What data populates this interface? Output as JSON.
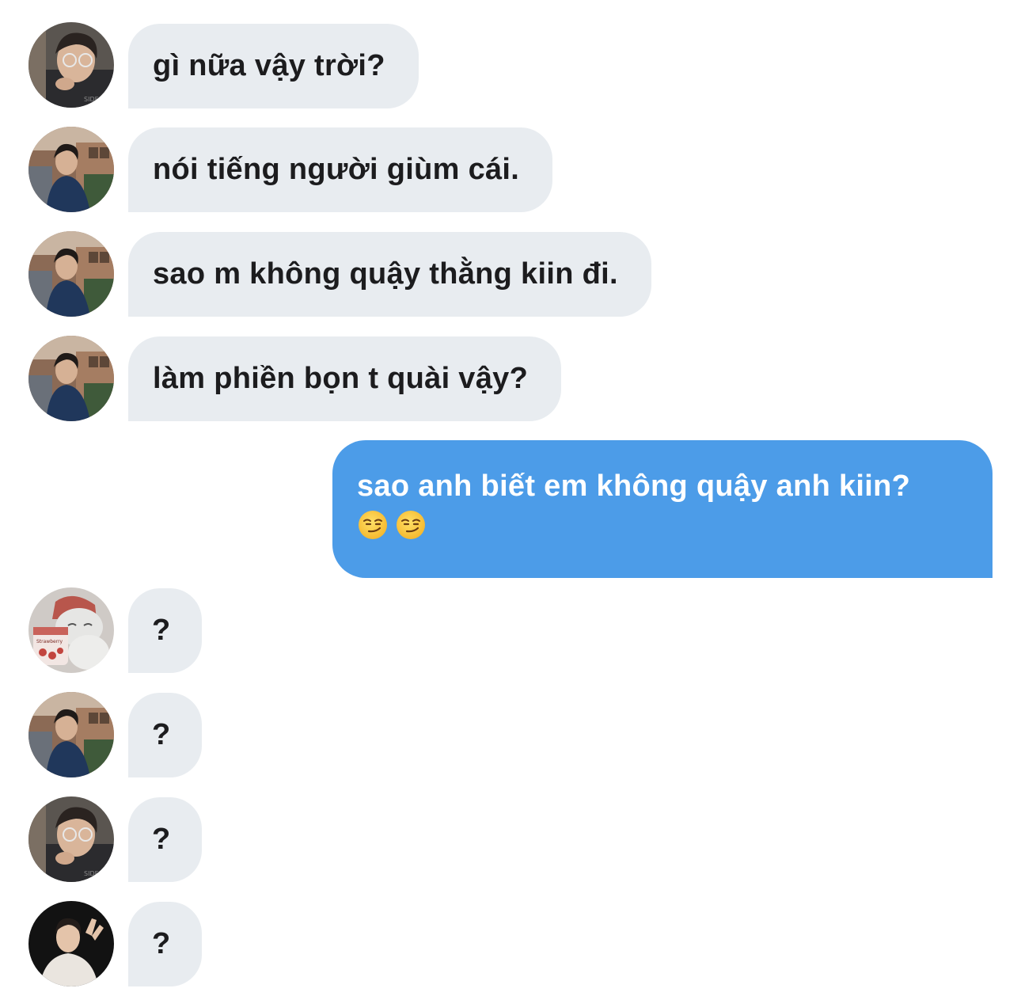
{
  "messages": [
    {
      "side": "in",
      "avatar": "avatar-glasses-boy-icon",
      "text": "gì nữa vậy trời?"
    },
    {
      "side": "in",
      "avatar": "avatar-street-boy-icon",
      "text": "nói tiếng người giùm cái."
    },
    {
      "side": "in",
      "avatar": "avatar-street-boy-icon",
      "text": "sao m không quậy thằng kiin đi."
    },
    {
      "side": "in",
      "avatar": "avatar-street-boy-icon",
      "text": "làm phiền bọn t quài vậy?"
    },
    {
      "side": "out",
      "text": "sao anh biết em không quậy anh kiin?",
      "emojis": [
        "smirk-emoji-icon",
        "smirk-emoji-icon"
      ]
    },
    {
      "side": "in",
      "avatar": "avatar-bear-icecream-icon",
      "text": "?"
    },
    {
      "side": "in",
      "avatar": "avatar-street-boy-icon",
      "text": "?"
    },
    {
      "side": "in",
      "avatar": "avatar-glasses-boy-icon",
      "text": "?"
    },
    {
      "side": "in",
      "avatar": "avatar-dark-boy-icon",
      "text": "?"
    }
  ],
  "colors": {
    "incoming_bubble": "#e8ecf0",
    "outgoing_bubble": "#4c9ce8",
    "incoming_text": "#1c1c1e",
    "outgoing_text": "#ffffff"
  }
}
